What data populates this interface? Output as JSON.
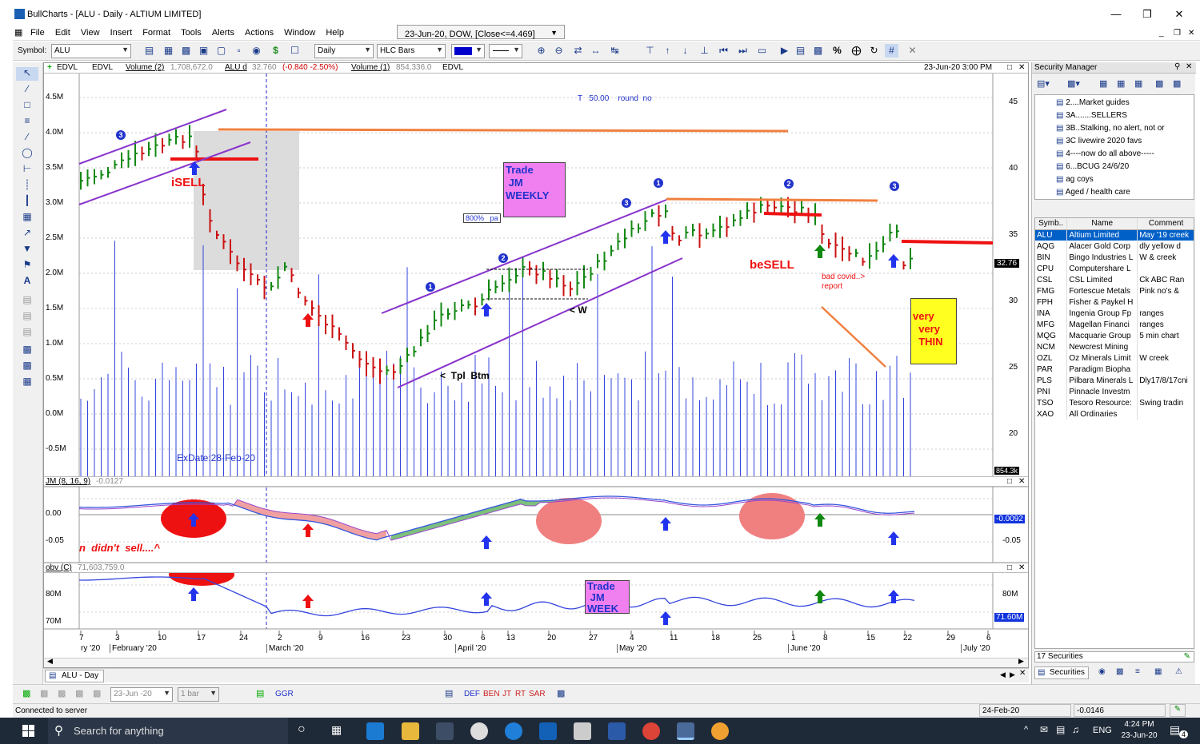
{
  "app": {
    "title": "BullCharts - [ALU - Daily - ALTIUM LIMITED]",
    "menu": [
      "File",
      "Edit",
      "View",
      "Insert",
      "Format",
      "Tools",
      "Alerts",
      "Actions",
      "Window",
      "Help"
    ],
    "info_combo": "23-Jun-20, DOW, [Close<=4.469]"
  },
  "toolbar": {
    "symbol_label": "Symbol:",
    "symbol_value": "ALU",
    "period_value": "Daily",
    "style_value": "HLC Bars"
  },
  "chart": {
    "header_items": [
      "EDVL",
      "EDVL",
      "Volume (2)",
      "1,708,672.0",
      "ALU d",
      "32.760",
      "(-0.840 -2.50%)",
      "Volume (1)",
      "854,336.0",
      "EDVL"
    ],
    "timestamp": "23-Jun-20 3:00 PM",
    "left_axis": [
      "4.5M",
      "4.0M",
      "3.5M",
      "3.0M",
      "2.5M",
      "2.0M",
      "1.5M",
      "1.0M",
      "0.5M",
      "0.0M",
      "-0.5M"
    ],
    "right_axis": [
      "45",
      "40",
      "35",
      "30",
      "25",
      "20"
    ],
    "last_price_tag": "32.76",
    "volume_tag": "854.3k",
    "annotations": {
      "t_label": "T   50.00    round  no",
      "isell": "iSELL",
      "besell": "beSELL",
      "trade_weekly": "Trade\n JM\nWEEKLY",
      "pct": "800%   pa",
      "w": "< W",
      "tpl": "<  Tpl  Btm",
      "covid": "bad covid..>\nreport",
      "thin": "very\n  very\n  THIN",
      "exdate": "ExDate:28-Feb-20"
    },
    "jm_header": "JM (8, 16, 9)",
    "jm_value": "-0.0127",
    "jm_axis": [
      "0.00",
      "-0.05"
    ],
    "jm_tag": "-0.0092",
    "jm_note": "n  didn't  sell....^",
    "obv_header": "obv (C)",
    "obv_value": "71,603,759.0",
    "obv_axis": [
      "80M",
      "70M"
    ],
    "obv_tag": "71.60M",
    "obv_trade": "Trade\n JM\nWEEK",
    "dates": [
      "7",
      "3",
      "10",
      "17",
      "24",
      "2",
      "9",
      "16",
      "23",
      "30",
      "6",
      "13",
      "20",
      "27",
      "4",
      "11",
      "18",
      "25",
      "1",
      "8",
      "15",
      "22",
      "29",
      "6"
    ],
    "months": [
      "ry '20",
      "February '20",
      "March '20",
      "April '20",
      "May '20",
      "June '20",
      "July '20"
    ],
    "tab_label": "ALU - Day"
  },
  "security_manager": {
    "title": "Security Manager",
    "folders": [
      "2....Market guides",
      "3A.......SELLERS",
      "3B..Stalking, no alert, not or",
      "3C   livewire 2020 favs",
      "4----now do all above-----",
      "6...BCUG 24/6/20",
      "ag   coys",
      "Aged / health  care"
    ],
    "columns": [
      "Symb..",
      "Name",
      "Comment"
    ],
    "rows": [
      [
        "ALU",
        "Altium Limited",
        "May '19 creek"
      ],
      [
        "AQG",
        "Alacer Gold Corp",
        "dly yellow  d"
      ],
      [
        "BIN",
        "Bingo Industries L",
        "W  & creek"
      ],
      [
        "CPU",
        "Computershare L",
        ""
      ],
      [
        "CSL",
        "CSL Limited",
        "Ck  ABC  Ran"
      ],
      [
        "FMG",
        "Fortescue Metals",
        "Pink no's  &"
      ],
      [
        "FPH",
        "Fisher & Paykel H",
        ""
      ],
      [
        "INA",
        "Ingenia Group Fp",
        "ranges"
      ],
      [
        "MFG",
        "Magellan Financi",
        "ranges"
      ],
      [
        "MQG",
        "Macquarie Group",
        "5  min  chart"
      ],
      [
        "NCM",
        "Newcrest Mining",
        ""
      ],
      [
        "OZL",
        "Oz Minerals Limit",
        "W  creek"
      ],
      [
        "PAR",
        "Paradigm Biopha",
        ""
      ],
      [
        "PLS",
        "Pilbara Minerals L",
        "Dly17/8/17cni"
      ],
      [
        "PNI",
        "Pinnacle Investm",
        ""
      ],
      [
        "TSO",
        "Tesoro Resource:",
        "Swing  tradin"
      ],
      [
        "XAO",
        "All Ordinaries",
        ""
      ]
    ],
    "count": "17 Securities",
    "tab": "Securities"
  },
  "bottom": {
    "date_combo": "23-Jun -20",
    "bars_combo": "1 bar",
    "ggr": "GGR",
    "links": [
      "DEF",
      "BEN",
      "JT",
      "RT",
      "SAR"
    ]
  },
  "status": {
    "left": "Connected to server",
    "date": "24-Feb-20",
    "value": "-0.0146"
  },
  "taskbar": {
    "search": "Search for anything",
    "lang": "ENG",
    "time": "4:24 PM",
    "date": "23-Jun-20",
    "notif": "4"
  }
}
